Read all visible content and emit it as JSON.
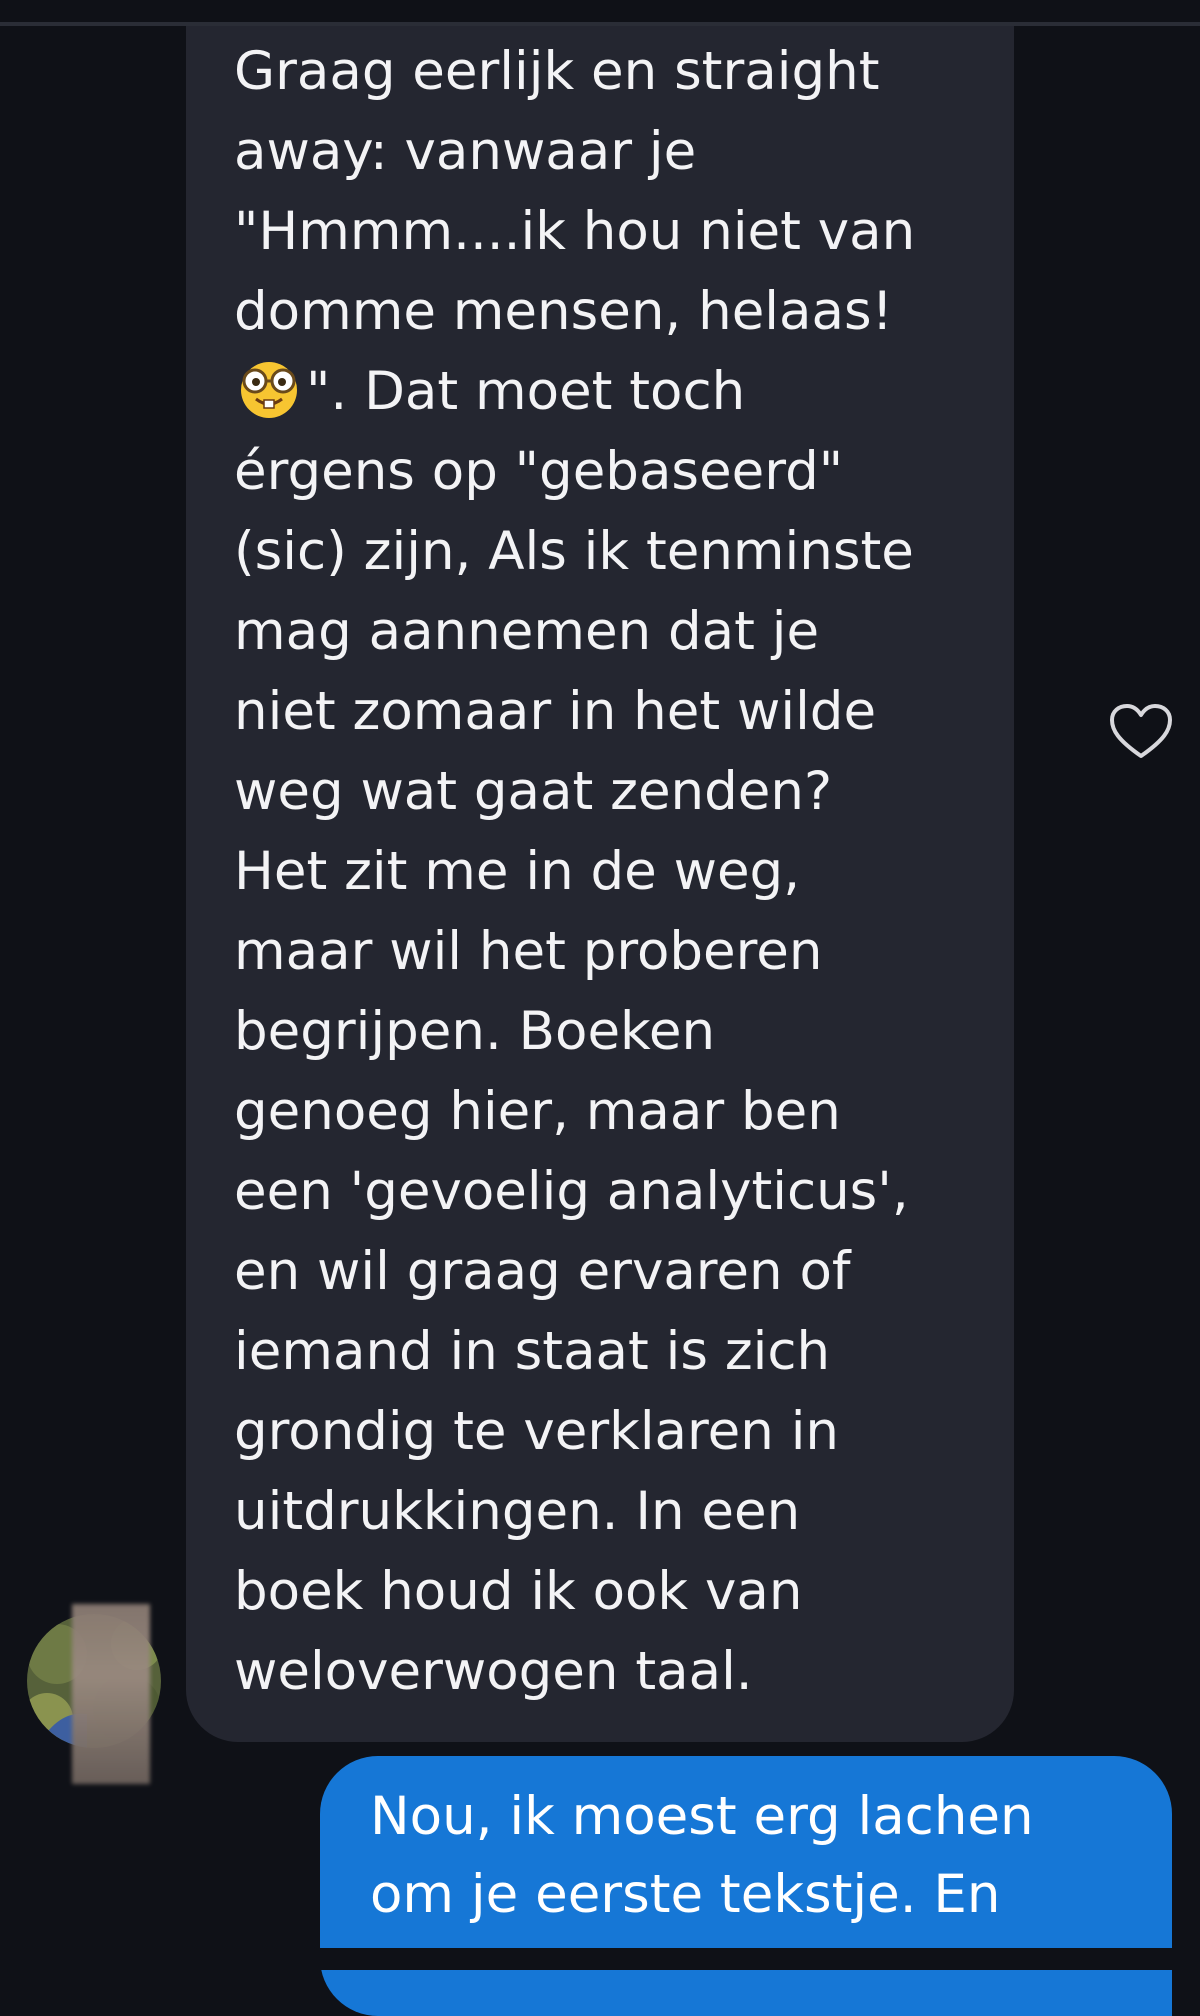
{
  "conversation": {
    "incoming_message": {
      "text_before_emoji": "Graag eerlijk en straight\naway: vanwaar je\n\"Hmmm....ik hou niet van\ndomme mensen, helaas!\n",
      "emoji_icon": "nerd-face-emoji",
      "text_after_emoji": "\". Dat moet toch\nérgens op \"gebaseerd\"\n(sic) zijn, Als ik tenminste\nmag aannemen dat je\nniet zomaar in het wilde\nweg wat gaat zenden?\nHet zit me in de weg,\nmaar wil het proberen\nbegrijpen. Boeken\ngenoeg hier, maar ben\neen 'gevoelig analyticus',\nen wil graag ervaren of\niemand in staat is zich\ngrondig te verklaren in\nuitdrukkingen. In een\nboek houd ik ook van\nweloverwogen taal."
    },
    "outgoing_message": {
      "text": "Nou, ik moest erg lachen\nom je eerste tekstje. En"
    },
    "reaction_icon": "heart-outline-icon"
  },
  "colors": {
    "background": "#0f1117",
    "incoming_bubble": "#242630",
    "outgoing_bubble": "#1677d6",
    "text": "#f3f3f5"
  }
}
